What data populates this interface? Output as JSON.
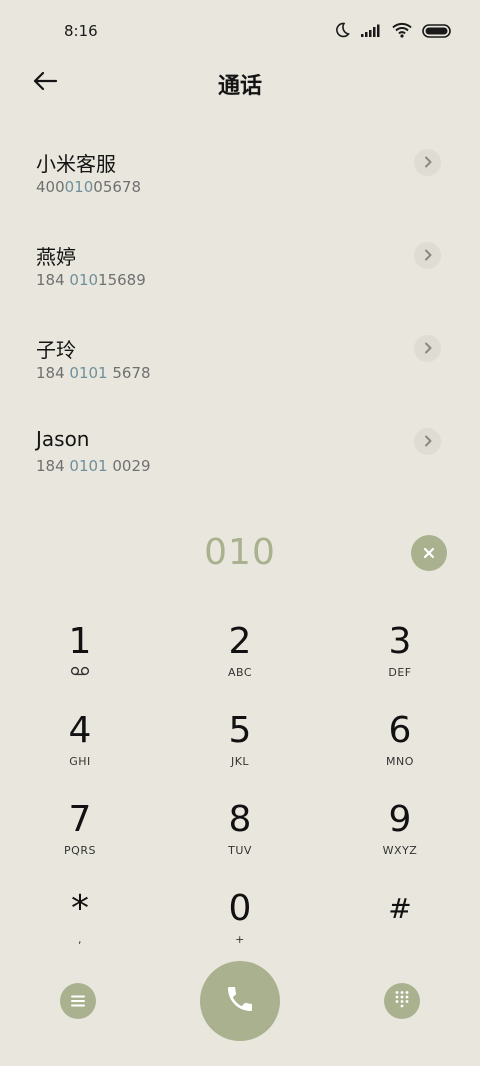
{
  "status": {
    "time": "8:16"
  },
  "header": {
    "title": "通话"
  },
  "contacts": [
    {
      "name": "小米客服",
      "num_pre": "400",
      "num_hl": "010",
      "num_post": "05678"
    },
    {
      "name": "燕婷",
      "num_pre": "184 ",
      "num_hl": "010",
      "num_post": "15689"
    },
    {
      "name": "子玲",
      "num_pre": "184 ",
      "num_hl": "0101",
      "num_post": " 5678"
    },
    {
      "name": "Jason",
      "num_pre": "184 ",
      "num_hl": "0101",
      "num_post": " 0029"
    }
  ],
  "entry": {
    "digits": "010"
  },
  "keypad": [
    {
      "digit": "1",
      "letters": ""
    },
    {
      "digit": "2",
      "letters": "ABC"
    },
    {
      "digit": "3",
      "letters": "DEF"
    },
    {
      "digit": "4",
      "letters": "GHI"
    },
    {
      "digit": "5",
      "letters": "JKL"
    },
    {
      "digit": "6",
      "letters": "MNO"
    },
    {
      "digit": "7",
      "letters": "PQRS"
    },
    {
      "digit": "8",
      "letters": "TUV"
    },
    {
      "digit": "9",
      "letters": "WXYZ"
    },
    {
      "digit": "*",
      "letters": ","
    },
    {
      "digit": "0",
      "letters": "+"
    },
    {
      "digit": "#",
      "letters": ""
    }
  ],
  "icons": {
    "back": "back-arrow-icon",
    "clear": "clear-x-icon",
    "voicemail": "voicemail-icon",
    "menu": "menu-icon",
    "call": "phone-icon",
    "dialpad": "dialpad-icon"
  },
  "colors": {
    "background": "#e9e7dd",
    "accent": "#aab18e",
    "highlight_digits": "#6f8f9c"
  }
}
